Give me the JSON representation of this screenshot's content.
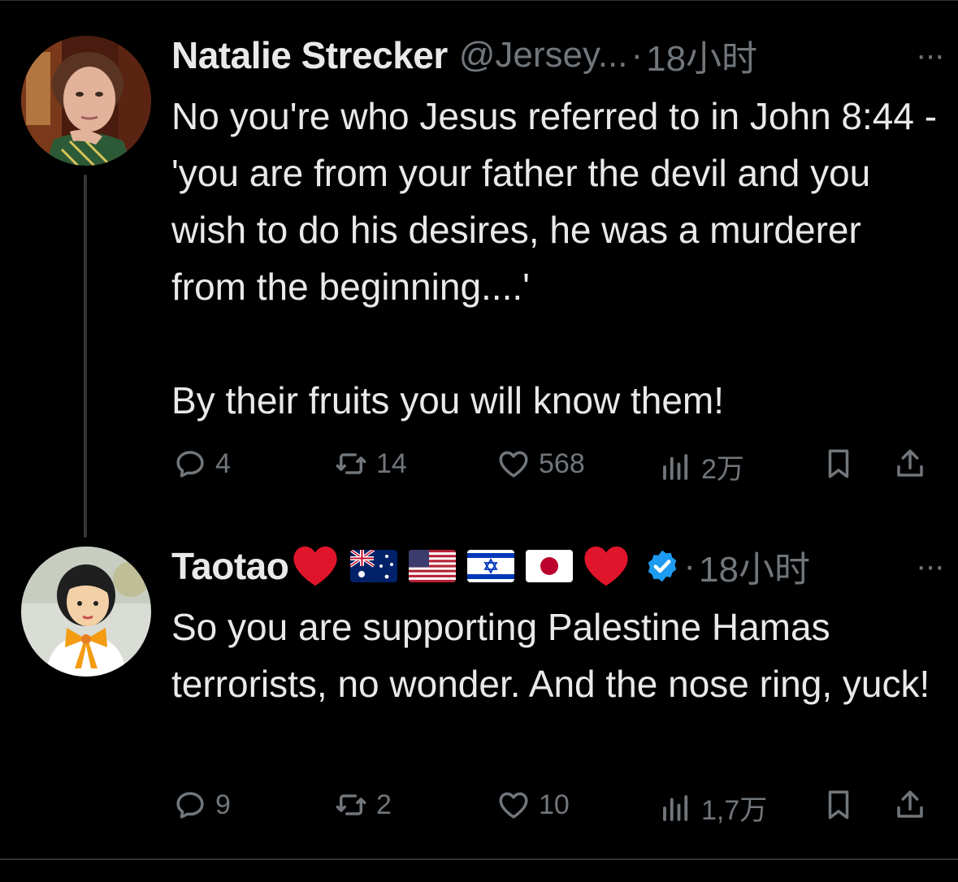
{
  "tweets": [
    {
      "name": "Natalie Strecker",
      "handle": "@Jersey...",
      "dot": "·",
      "time": "18小时",
      "more": "···",
      "text": "No you're who Jesus referred to in John 8:44 - 'you are from your father the devil and you wish to do his desires, he was a murderer from the beginning....'\n\nBy their fruits you will know them!",
      "replies": "4",
      "retweets": "14",
      "likes": "568",
      "views": "2万"
    },
    {
      "name": "Taotao",
      "dot": "·",
      "time": "18小时",
      "more": "···",
      "text": "So you are supporting Palestine Hamas terrorists, no wonder. And the nose ring, yuck!",
      "replies": "9",
      "retweets": "2",
      "likes": "10",
      "views": "1,7万"
    }
  ],
  "colors": {
    "background": "#000000",
    "text": "#e7e9ea",
    "muted": "#71767b",
    "verified": "#1d9bf0",
    "heart": "#e0142a"
  },
  "icons": [
    "reply-icon",
    "retweet-icon",
    "like-icon",
    "views-icon",
    "bookmark-icon",
    "share-icon",
    "verified-icon",
    "more-icon"
  ]
}
